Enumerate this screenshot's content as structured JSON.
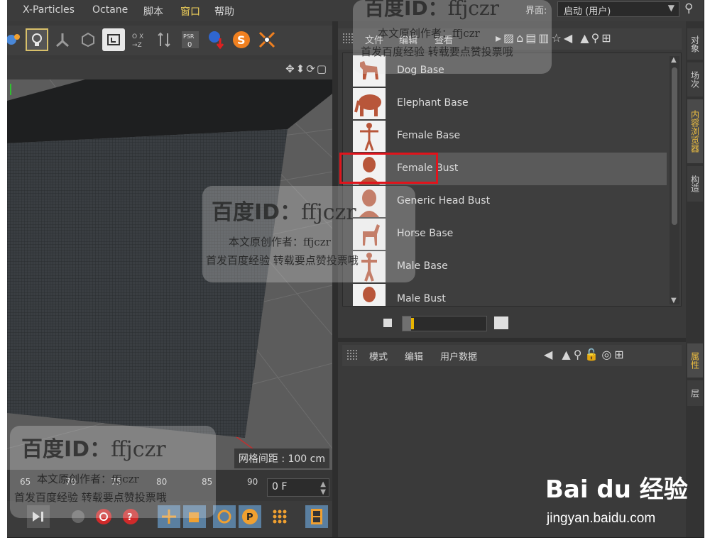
{
  "menubar": {
    "items": [
      "X-Particles",
      "Octane",
      "脚本",
      "窗口",
      "帮助"
    ],
    "active_index": 3,
    "layout_label": "界面:",
    "layout_value": "启动 (用户)"
  },
  "content_browser": {
    "menu": [
      "文件",
      "编辑",
      "查看"
    ],
    "items": [
      {
        "label": "Dog Base",
        "thumb": "dog-icon"
      },
      {
        "label": "Elephant Base",
        "thumb": "elephant-icon"
      },
      {
        "label": "Female Base",
        "thumb": "female-figure-icon"
      },
      {
        "label": "Female Bust",
        "thumb": "female-bust-icon"
      },
      {
        "label": "Generic Head Bust",
        "thumb": "head-bust-icon"
      },
      {
        "label": "Horse Base",
        "thumb": "horse-icon"
      },
      {
        "label": "Male Base",
        "thumb": "male-figure-icon"
      },
      {
        "label": "Male Bust",
        "thumb": "male-bust-icon"
      }
    ],
    "selected_index": 3,
    "thumbnail_size_level": 0.1
  },
  "viewport": {
    "grid_spacing_label": "网格间距 : 100 cm"
  },
  "timeline": {
    "ticks": [
      "65",
      "70",
      "75",
      "80",
      "85",
      "90"
    ],
    "current_frame": "0 F"
  },
  "attributes": {
    "menu": [
      "模式",
      "编辑",
      "用户数据"
    ]
  },
  "side_tabs": {
    "top": [
      "对象",
      "场次",
      "内容浏览器",
      "构造"
    ],
    "top_active": 2,
    "bottom": [
      "属性",
      "层"
    ],
    "bottom_active": 0
  },
  "watermark": {
    "title": "百度ID：",
    "handle": "ffjczr",
    "line1": "本文原创作者：ffjczr",
    "line2": "首发百度经验 转载要点赞投票哦",
    "brand_logo": "Bai du 经验",
    "brand_url": "jingyan.baidu.com"
  },
  "colors": {
    "accent_yellow": "#f0c040",
    "selection_red": "#e0141c",
    "panel_bg": "#3a3a3a"
  }
}
